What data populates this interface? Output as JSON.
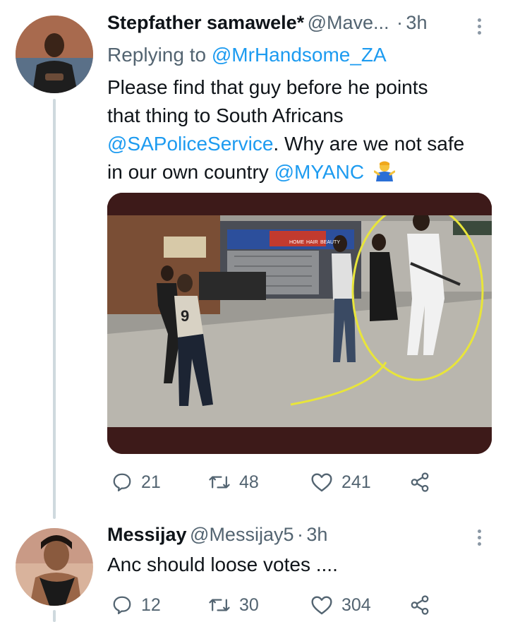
{
  "tweet1": {
    "name": "Stepfather samawele*",
    "handle": "@Mave...",
    "dot": "·",
    "time": "3h",
    "replying_prefix": "Replying to ",
    "replying_to": "@MrHandsome_ZA",
    "line1": "Please find that guy before he points",
    "line2": "that thing to South Africans",
    "mention_police": "@SAPoliceService",
    "line3_rest": ". Why are we not safe",
    "line4_start": "in our own country ",
    "mention_anc": "@MYANC",
    "emoji": "🤷‍♂️",
    "replies": "21",
    "retweets": "48",
    "likes": "241"
  },
  "media_overlay": {
    "shop_sign_1": "HOME",
    "shop_sign_2": "HAIR",
    "shop_sign_3": "BEAUTY",
    "jersey_number": "9"
  },
  "tweet2": {
    "name": "Messijay",
    "handle": "@Messijay5",
    "dot": "·",
    "time": "3h",
    "text": "Anc should loose votes ....",
    "replies": "12",
    "retweets": "30",
    "likes": "304"
  },
  "icons": {
    "reply": "reply-icon",
    "retweet": "retweet-icon",
    "like": "heart-icon",
    "share": "share-icon",
    "more": "more-icon"
  },
  "colors": {
    "link": "#1d9bf0",
    "secondary_text": "#536471",
    "media_bar": "#3d1a19",
    "highlight_circle": "#e8e53a"
  }
}
